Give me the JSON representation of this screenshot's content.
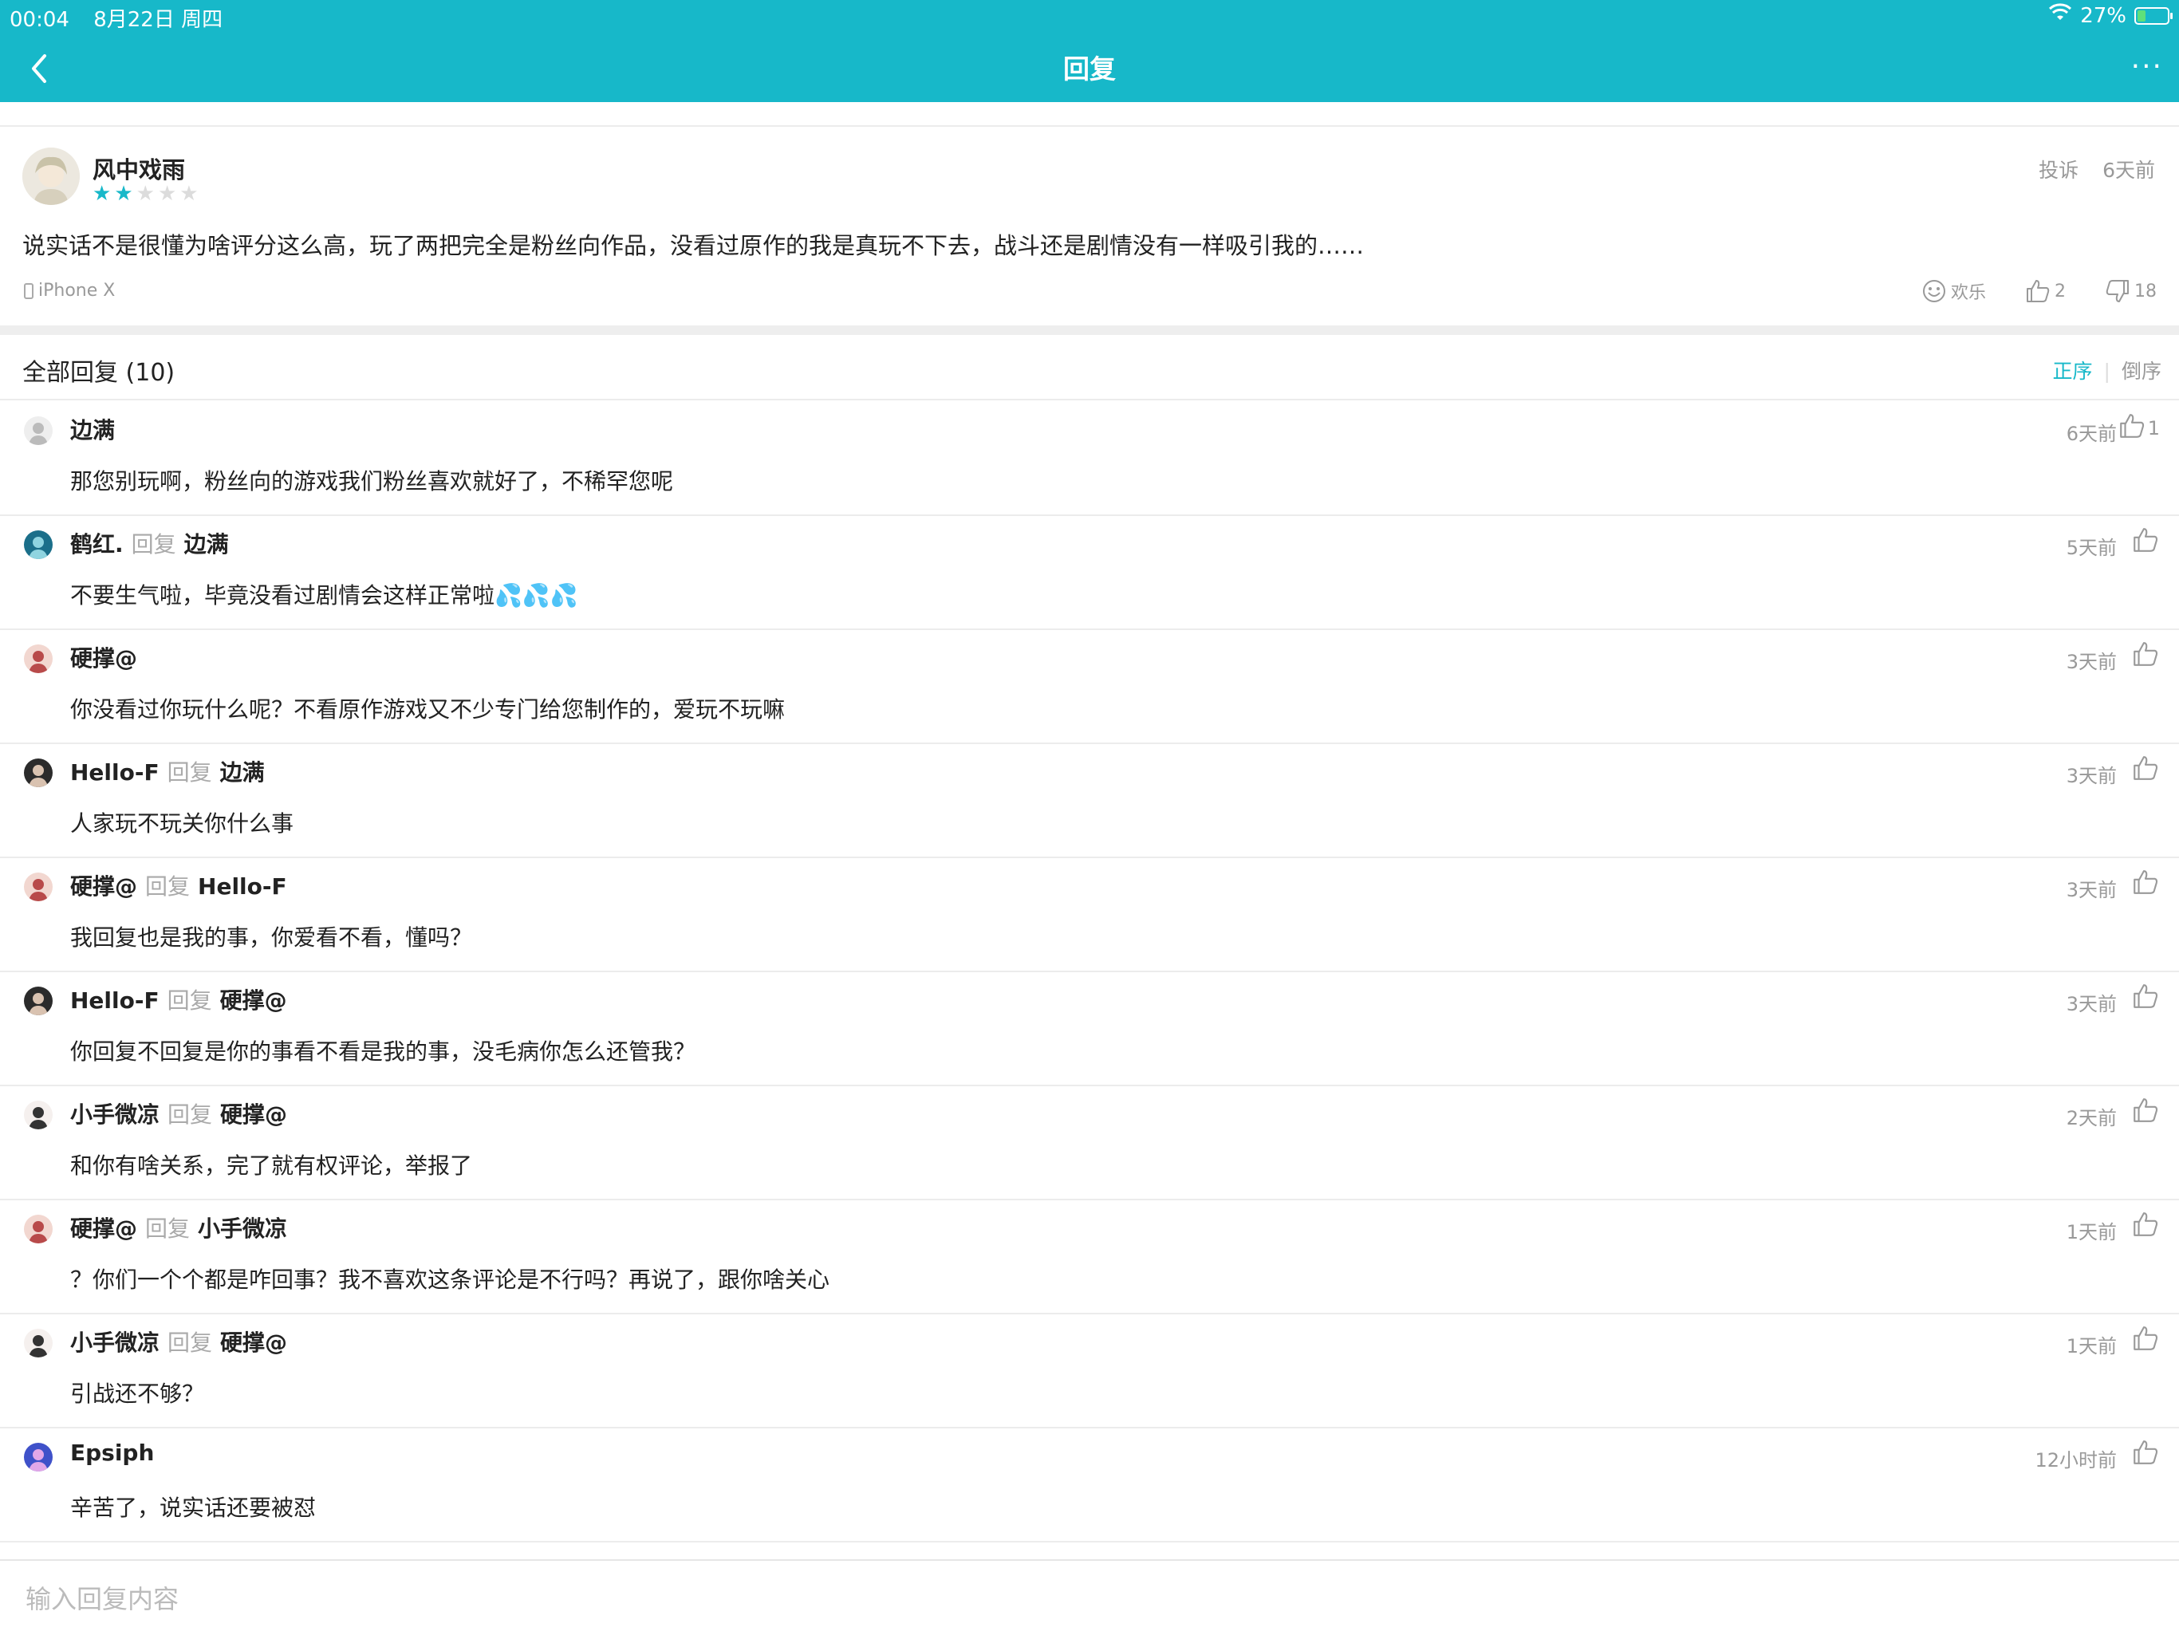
{
  "status_bar": {
    "time": "00:04",
    "date": "8月22日 周四",
    "battery": "27%",
    "battery_level": 0.27
  },
  "nav": {
    "title": "回复",
    "more": "···"
  },
  "review": {
    "user": "风中戏雨",
    "rating": 2,
    "rating_max": 5,
    "complain": "投诉",
    "time": "6天前",
    "text": "说实话不是很懂为啥评分这么高，玩了两把完全是粉丝向作品，没看过原作的我是真玩不下去，战斗还是剧情没有一样吸引我的……",
    "device": "iPhone X",
    "funny_label": "欢乐",
    "likes": "2",
    "dislikes": "18"
  },
  "replies_header": {
    "title": "全部回复 (10)",
    "sort_asc": "正序",
    "sort_desc": "倒序"
  },
  "replies": [
    {
      "user": "边满",
      "reply_word": "",
      "target": "",
      "time": "6天前",
      "likes": "1",
      "text": "那您别玩啊，粉丝向的游戏我们粉丝喜欢就好了，不稀罕您呢",
      "drops": ""
    },
    {
      "user": "鹤红.",
      "reply_word": "回复",
      "target": "边满",
      "time": "5天前",
      "likes": "",
      "text": "不要生气啦，毕竟没看过剧情会这样正常啦",
      "drops": "💦💦💦"
    },
    {
      "user": "硬撑@",
      "reply_word": "",
      "target": "",
      "time": "3天前",
      "likes": "",
      "text": "你没看过你玩什么呢？不看原作游戏又不少专门给您制作的，爱玩不玩嘛",
      "drops": ""
    },
    {
      "user": "Hello-F",
      "reply_word": "回复",
      "target": "边满",
      "time": "3天前",
      "likes": "",
      "text": "人家玩不玩关你什么事",
      "drops": ""
    },
    {
      "user": "硬撑@",
      "reply_word": "回复",
      "target": "Hello-F",
      "time": "3天前",
      "likes": "",
      "text": "我回复也是我的事，你爱看不看，懂吗？",
      "drops": ""
    },
    {
      "user": "Hello-F",
      "reply_word": "回复",
      "target": "硬撑@",
      "time": "3天前",
      "likes": "",
      "text": "你回复不回复是你的事看不看是我的事，没毛病你怎么还管我？",
      "drops": ""
    },
    {
      "user": "小手微凉",
      "reply_word": "回复",
      "target": "硬撑@",
      "time": "2天前",
      "likes": "",
      "text": "和你有啥关系，完了就有权评论，举报了",
      "drops": ""
    },
    {
      "user": "硬撑@",
      "reply_word": "回复",
      "target": "小手微凉",
      "time": "1天前",
      "likes": "",
      "text": "？你们一个个都是咋回事？我不喜欢这条评论是不行吗？再说了，跟你啥关心",
      "drops": ""
    },
    {
      "user": "小手微凉",
      "reply_word": "回复",
      "target": "硬撑@",
      "time": "1天前",
      "likes": "",
      "text": "引战还不够？",
      "drops": ""
    },
    {
      "user": "Epsiph",
      "reply_word": "",
      "target": "",
      "time": "12小时前",
      "likes": "",
      "text": "辛苦了，说实话还要被怼",
      "drops": ""
    }
  ],
  "input": {
    "placeholder": "输入回复内容",
    "value": ""
  },
  "colors": {
    "accent": "#17b8c9",
    "text": "#222222",
    "muted": "#999999",
    "divider": "#ececec"
  }
}
